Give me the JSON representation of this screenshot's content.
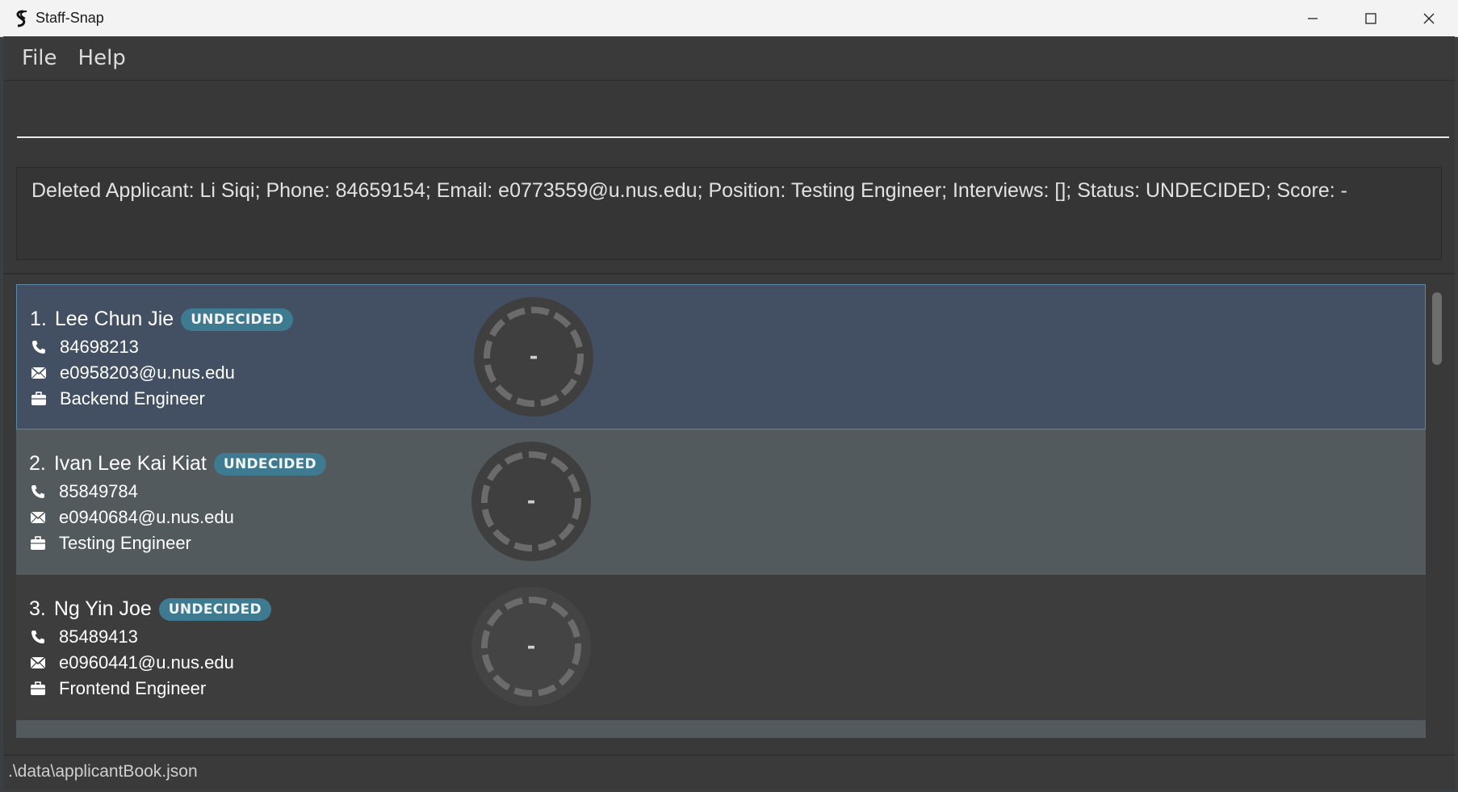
{
  "window": {
    "title": "Staff-Snap",
    "controls": [
      "minimize-icon",
      "maximize-icon",
      "close-icon"
    ]
  },
  "menu": {
    "file": "File",
    "help": "Help"
  },
  "command": {
    "value": "",
    "placeholder": ""
  },
  "result": {
    "text": "Deleted Applicant: Li Siqi; Phone: 84659154; Email: e0773559@u.nus.edu; Position: Testing Engineer; Interviews: []; Status: UNDECIDED; Score: -"
  },
  "applicants": [
    {
      "index": "1.",
      "name": "Lee Chun Jie",
      "status": "UNDECIDED",
      "phone": "84698213",
      "email": "e0958203@u.nus.edu",
      "position": "Backend Engineer",
      "score": "-"
    },
    {
      "index": "2.",
      "name": "Ivan Lee Kai Kiat",
      "status": "UNDECIDED",
      "phone": "85849784",
      "email": "e0940684@u.nus.edu",
      "position": "Testing Engineer",
      "score": "-"
    },
    {
      "index": "3.",
      "name": "Ng Yin Joe",
      "status": "UNDECIDED",
      "phone": "85489413",
      "email": "e0960441@u.nus.edu",
      "position": "Frontend Engineer",
      "score": "-"
    }
  ],
  "status_bar": {
    "path": ".\\data\\applicantBook.json"
  },
  "colors": {
    "selected_card": "#435063",
    "odd_card": "#535a5e",
    "even_card": "#3d3d3d",
    "badge": "#3e7b91"
  },
  "icons": {
    "phone": "phone-icon",
    "email": "envelope-icon",
    "position": "briefcase-icon"
  }
}
